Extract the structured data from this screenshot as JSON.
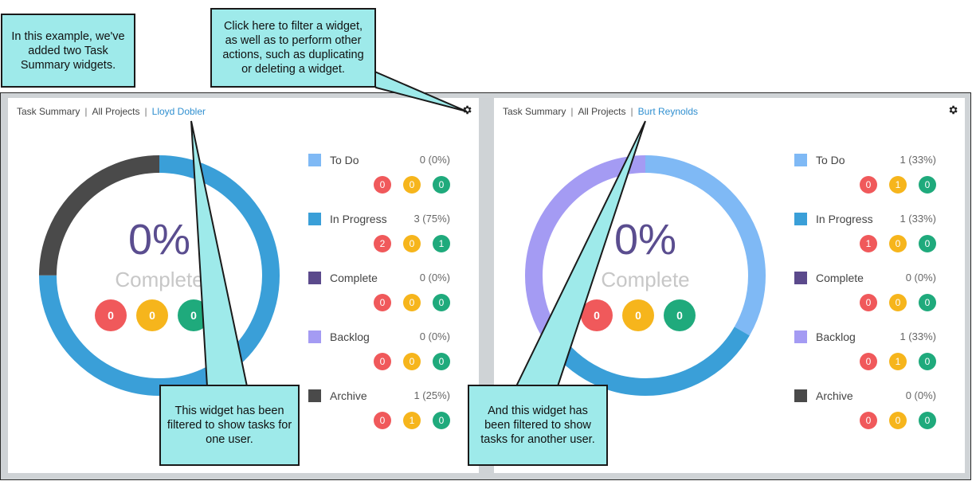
{
  "colors": {
    "todo": "#7fb9f5",
    "in_progress": "#3a9fd8",
    "complete": "#5b4a8c",
    "backlog": "#a49bf3",
    "archive": "#4a4a4a",
    "red": "#f0595b",
    "yellow": "#f6b51c",
    "green": "#1faa7c"
  },
  "widgets": [
    {
      "title": "Task Summary",
      "scope": "All Projects",
      "user": "Lloyd Dobler",
      "percent": "0%",
      "complete_label": "Complete",
      "center_counts": [
        "0",
        "0",
        "0"
      ],
      "legend": [
        {
          "name": "To Do",
          "count": "0 (0%)",
          "pills": [
            "0",
            "0",
            "0"
          ]
        },
        {
          "name": "In Progress",
          "count": "3 (75%)",
          "pills": [
            "2",
            "0",
            "1"
          ]
        },
        {
          "name": "Complete",
          "count": "0 (0%)",
          "pills": [
            "0",
            "0",
            "0"
          ]
        },
        {
          "name": "Backlog",
          "count": "0 (0%)",
          "pills": [
            "0",
            "0",
            "0"
          ]
        },
        {
          "name": "Archive",
          "count": "1 (25%)",
          "pills": [
            "0",
            "1",
            "0"
          ]
        }
      ],
      "donut_shares": {
        "todo": 0,
        "in_progress": 0.75,
        "complete": 0,
        "backlog": 0,
        "archive": 0.25
      }
    },
    {
      "title": "Task Summary",
      "scope": "All Projects",
      "user": "Burt Reynolds",
      "percent": "0%",
      "complete_label": "Complete",
      "center_counts": [
        "0",
        "0",
        "0"
      ],
      "legend": [
        {
          "name": "To Do",
          "count": "1 (33%)",
          "pills": [
            "0",
            "1",
            "0"
          ]
        },
        {
          "name": "In Progress",
          "count": "1 (33%)",
          "pills": [
            "1",
            "0",
            "0"
          ]
        },
        {
          "name": "Complete",
          "count": "0 (0%)",
          "pills": [
            "0",
            "0",
            "0"
          ]
        },
        {
          "name": "Backlog",
          "count": "1 (33%)",
          "pills": [
            "0",
            "1",
            "0"
          ]
        },
        {
          "name": "Archive",
          "count": "0 (0%)",
          "pills": [
            "0",
            "0",
            "0"
          ]
        }
      ],
      "donut_shares": {
        "todo": 0.333,
        "in_progress": 0.333,
        "complete": 0,
        "backlog": 0.334,
        "archive": 0
      }
    }
  ],
  "callouts": {
    "intro": "In this example, we've added two Task Summary widgets.",
    "gear": "Click here to filter a widget, as well as to perform other actions, such as duplicating or deleting a widget.",
    "widget1": "This widget has been filtered to show tasks for one user.",
    "widget2": "And this widget has been filtered to show tasks for another user."
  }
}
